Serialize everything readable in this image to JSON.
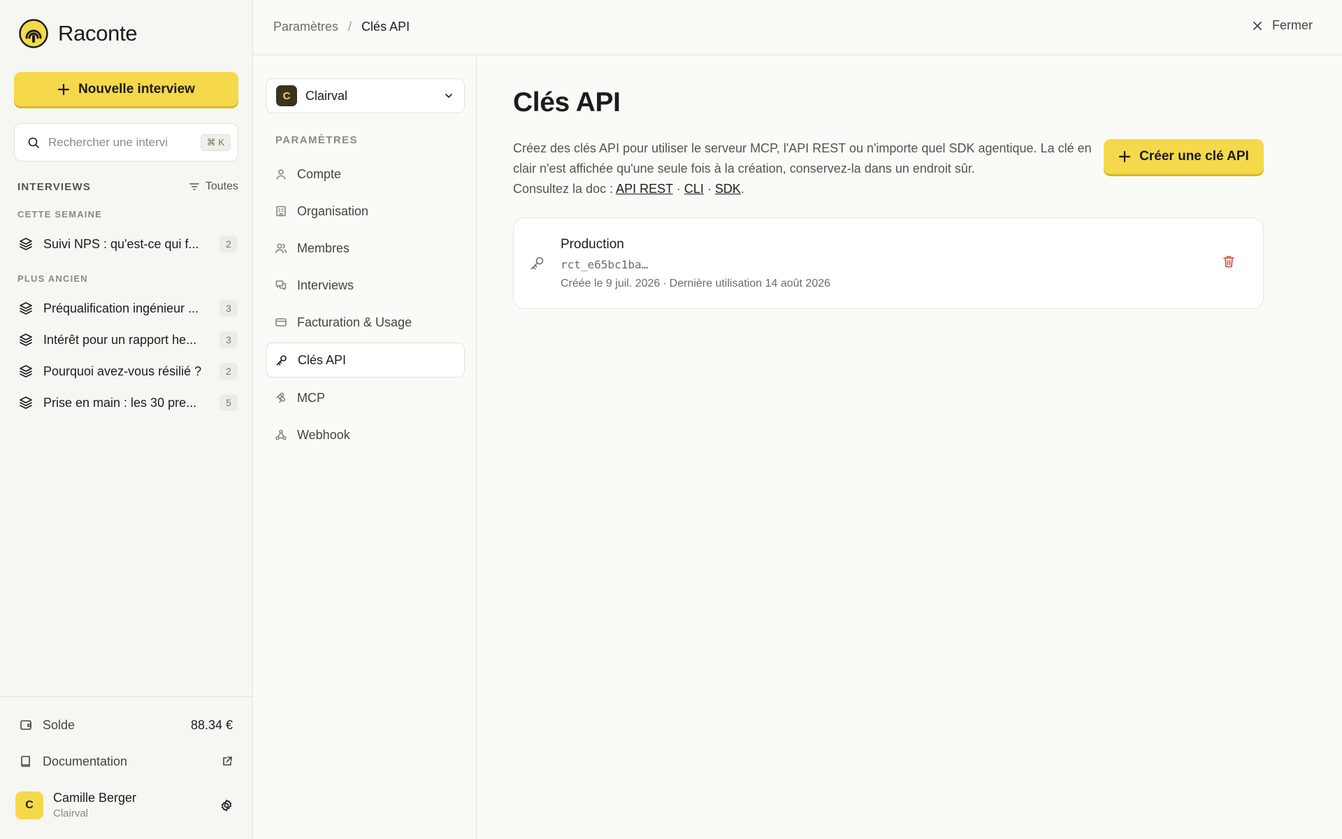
{
  "app": {
    "name": "Raconte"
  },
  "sidebar": {
    "new_interview_label": "Nouvelle interview",
    "search": {
      "placeholder": "Rechercher une intervi",
      "shortcut": "⌘ K"
    },
    "section_title": "INTERVIEWS",
    "filter_label": "Toutes",
    "groups": [
      {
        "label": "CETTE SEMAINE",
        "items": [
          {
            "label": "Suivi NPS : qu'est-ce qui f...",
            "count": "2"
          }
        ]
      },
      {
        "label": "PLUS ANCIEN",
        "items": [
          {
            "label": "Préqualification ingénieur ...",
            "count": "3"
          },
          {
            "label": "Intérêt pour un rapport he...",
            "count": "3"
          },
          {
            "label": "Pourquoi avez-vous résilié ?",
            "count": "2"
          },
          {
            "label": "Prise en main : les 30 pre...",
            "count": "5"
          }
        ]
      }
    ],
    "balance": {
      "label": "Solde",
      "value": "88.34 €"
    },
    "documentation_label": "Documentation",
    "user": {
      "initial": "C",
      "name": "Camille Berger",
      "org": "Clairval"
    }
  },
  "topbar": {
    "breadcrumb": [
      "Paramètres",
      "Clés API"
    ],
    "breadcrumb_sep": "/",
    "close_label": "Fermer"
  },
  "settings_nav": {
    "org": {
      "initial": "C",
      "name": "Clairval"
    },
    "title": "PARAMÈTRES",
    "items": [
      {
        "label": "Compte",
        "icon": "user-icon"
      },
      {
        "label": "Organisation",
        "icon": "building-icon"
      },
      {
        "label": "Membres",
        "icon": "users-icon"
      },
      {
        "label": "Interviews",
        "icon": "chat-icon"
      },
      {
        "label": "Facturation & Usage",
        "icon": "credit-card-icon"
      },
      {
        "label": "Clés API",
        "icon": "key-icon",
        "active": true
      },
      {
        "label": "MCP",
        "icon": "mcp-icon"
      },
      {
        "label": "Webhook",
        "icon": "webhook-icon"
      }
    ]
  },
  "main": {
    "title": "Clés API",
    "description": {
      "line1": "Créez des clés API pour utiliser le serveur MCP, l'API REST ou n'importe quel SDK agentique. La clé en clair n'est affichée qu'une seule fois à la création, conservez-la dans un endroit sûr.",
      "doc_prefix": "Consultez la doc :",
      "links": [
        "API REST",
        "CLI",
        "SDK"
      ],
      "link_sep": "·",
      "end": "."
    },
    "create_label": "Créer une clé API",
    "keys": [
      {
        "name": "Production",
        "prefix": "rct_e65bc1ba…",
        "created": "Créée le 9 juil. 2026",
        "last_used": "Dernière utilisation 14 août 2026"
      }
    ]
  },
  "colors": {
    "accent": "#f5d94a",
    "accent_shadow": "#d8b81e",
    "danger": "#d9443a",
    "background": "#fafaf7",
    "sidebar": "#f6f6f2"
  }
}
